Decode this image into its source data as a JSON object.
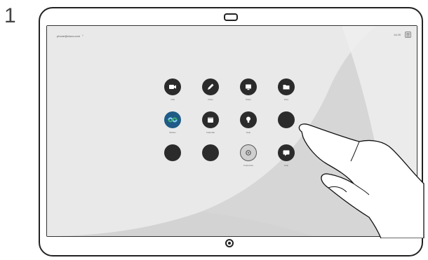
{
  "step_number": "1",
  "device": {
    "screen": {
      "topbar": {
        "address": "phone@cisco.com",
        "chevron": "›",
        "time": "14:25"
      },
      "tiles": [
        {
          "label": "Call",
          "icon": "camera-icon"
        },
        {
          "label": "Draw",
          "icon": "pen-icon"
        },
        {
          "label": "Share",
          "icon": "share-screen-icon"
        },
        {
          "label": "Files",
          "icon": "folder-icon"
        },
        {
          "label": "Webex",
          "icon": "webex-icon"
        },
        {
          "label": "Calendar",
          "icon": "calendar-icon"
        },
        {
          "label": "Help",
          "icon": "lightbulb-icon"
        },
        {
          "label": "",
          "icon": "blank-app-icon"
        },
        {
          "label": "",
          "icon": "blank-app-icon"
        },
        {
          "label": "",
          "icon": "blank-app-icon"
        },
        {
          "label": "Customize",
          "icon": "gear-icon"
        },
        {
          "label": "Help",
          "icon": "chat-icon"
        }
      ]
    }
  },
  "colors": {
    "tile_dark": "#2b2b2b",
    "webex_blue": "#1f5b86",
    "screen_bg": "#d5d5d5"
  }
}
